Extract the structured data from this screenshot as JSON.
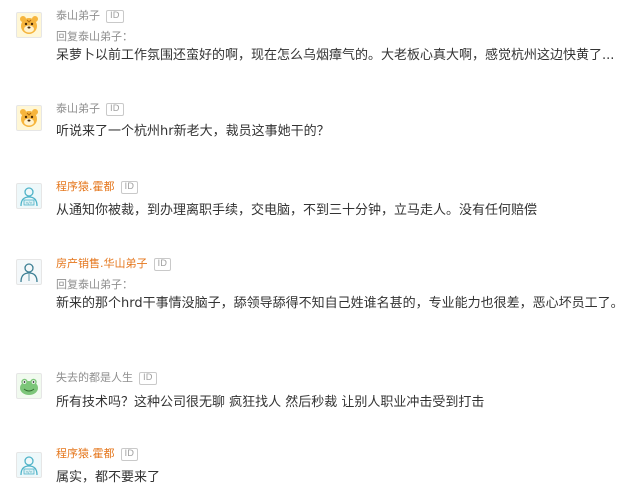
{
  "comments": [
    {
      "username": "泰山弟子",
      "name_color": "gray",
      "avatar": "tiger-avatar-icon",
      "reply_prefix": "回复",
      "reply_to": "泰山弟子",
      "reply_suffix": "：",
      "content": "呆萝卜以前工作氛围还蛮好的啊，现在怎么乌烟瘴气的。大老板心真大啊，感觉杭州这边快黄了..."
    },
    {
      "username": "泰山弟子",
      "name_color": "gray",
      "avatar": "tiger-avatar-icon",
      "content": "听说来了一个杭州hr新老大，裁员这事她干的？"
    },
    {
      "username": "程序猿.霍都",
      "name_color": "orange",
      "avatar": "programmer-avatar-icon",
      "content": "从通知你被裁，到办理离职手续，交电脑，不到三十分钟，立马走人。没有任何赔偿"
    },
    {
      "username": "房产销售.华山弟子",
      "name_color": "orange",
      "avatar": "person-avatar-icon",
      "reply_prefix": "回复",
      "reply_to": "泰山弟子",
      "reply_suffix": "：",
      "content": "新来的那个hrd干事情没脑子，舔领导舔得不知自己姓谁名甚的，专业能力也很差，恶心坏员工了。"
    },
    {
      "username": "失去的都是人生",
      "name_color": "gray",
      "avatar": "frog-avatar-icon",
      "content": "所有技术吗？这种公司很无聊 疯狂找人 然后秒裁 让别人职业冲击受到打击"
    },
    {
      "username": "程序猿.霍都",
      "name_color": "orange",
      "avatar": "programmer-avatar-icon",
      "content": "属实，都不要来了"
    }
  ],
  "id_badge": "ID"
}
